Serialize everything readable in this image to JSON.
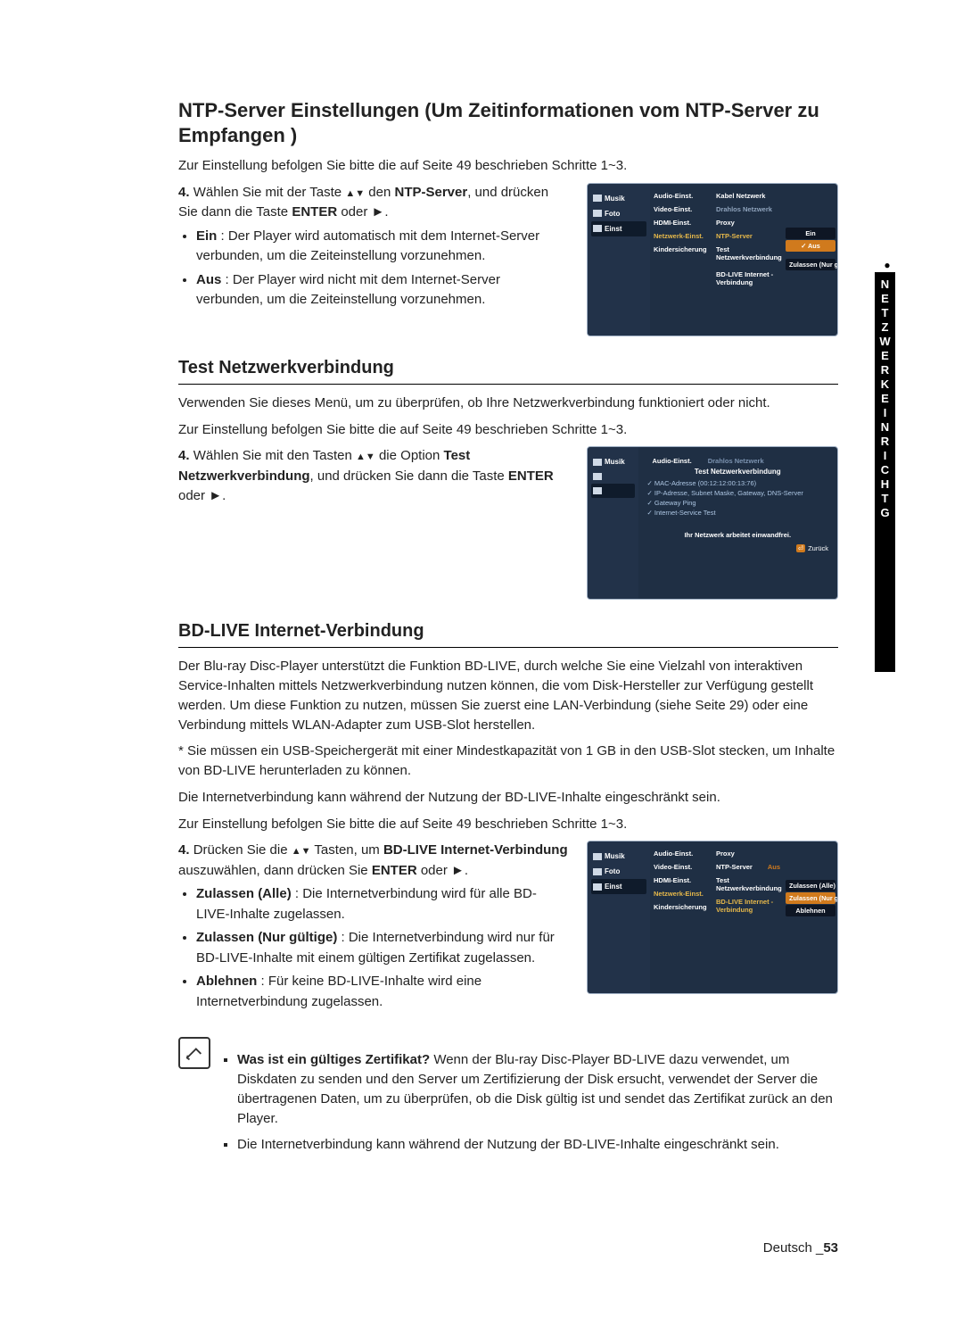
{
  "sidetab": {
    "label": "NETZWERKEINRICHTG"
  },
  "h1": "NTP-Server Einstellungen (Um Zeitinformationen vom NTP-Server zu Empfangen )",
  "intro1": "Zur Einstellung befolgen Sie bitte die auf Seite 49 beschrieben Schritte 1~3.",
  "step4a": {
    "num": "4.",
    "lead_a": "Wählen Sie mit der Taste ",
    "lead_b": " den ",
    "key_name": "NTP-Server",
    "lead_c": ", und drücken Sie dann die Taste ",
    "enter": "ENTER",
    "lead_d": " oder ",
    "tri": "►",
    "lead_e": ".",
    "bullets": [
      {
        "name": "Ein",
        "text": " : Der Player wird automatisch mit dem Internet-Server verbunden, um die Zeiteinstellung vorzunehmen."
      },
      {
        "name": "Aus",
        "text": " : Der Player wird nicht mit dem Internet-Server verbunden, um die Zeiteinstellung vorzunehmen."
      }
    ]
  },
  "osd1": {
    "side": [
      "Musik",
      "Foto",
      "Einst"
    ],
    "colA": [
      "Audio-Einst.",
      "Video-Einst.",
      "HDMI-Einst.",
      "Netzwerk-Einst.",
      "Kindersicherung"
    ],
    "colB": [
      "Kabel Netzwerk",
      "Drahlos Netzwerk",
      "Proxy",
      "NTP-Server",
      "Test Netzwerkverbindung",
      "BD-LIVE\nInternet - Verbindung"
    ],
    "colC": [
      "Ein",
      "✓ Aus",
      "Zulassen\n(Nur gültige)"
    ]
  },
  "h2": "Test Netzwerkverbindung",
  "test_intro": "Verwenden Sie dieses Menü, um zu überprüfen, ob Ihre Netzwerkverbindung funktioniert oder nicht.",
  "intro2": "Zur Einstellung befolgen Sie bitte die auf Seite 49 beschrieben Schritte 1~3.",
  "step4b": {
    "num": "4.",
    "lead_a": "Wählen Sie mit den Tasten ",
    "lead_b": " die Option ",
    "key_name": "Test Netzwerkverbindung",
    "lead_c": ", und drücken Sie dann die Taste ",
    "enter": "ENTER",
    "lead_d": " oder ",
    "tri": "►",
    "lead_e": "."
  },
  "osd2": {
    "topA": "Audio-Einst.",
    "topB": "Drahlos Netzwerk",
    "title": "Test Netzwerkverbindung",
    "checks": [
      "✓ MAC-Adresse (00:12:12:00:13:76)",
      "✓ IP-Adresse, Subnet Maske, Gateway, DNS-Server",
      "✓ Gateway Ping",
      "✓ Internet-Service Test"
    ],
    "status": "Ihr Netzwerk arbeitet einwandfrei.",
    "back_pre": "⏎",
    "back": "Zurück",
    "side": [
      "Musik",
      "",
      ""
    ]
  },
  "h3": "BD-LIVE Internet-Verbindung",
  "bd_paras": [
    "Der Blu-ray Disc-Player unterstützt die Funktion BD-LIVE, durch welche Sie eine Vielzahl von interaktiven Service-Inhalten mittels Netzwerkverbindung nutzen können, die vom Disk-Hersteller zur Verfügung gestellt werden. Um diese Funktion zu nutzen, müssen Sie zuerst eine LAN-Verbindung (siehe Seite 29) oder eine Verbindung mittels WLAN-Adapter zum USB-Slot herstellen.",
    "* Sie müssen ein USB-Speichergerät mit einer Mindestkapazität von 1 GB in den USB-Slot stecken, um Inhalte von BD-LIVE herunterladen zu können.",
    "Die Internetverbindung kann während der Nutzung der BD-LIVE-Inhalte eingeschränkt sein.",
    "Zur Einstellung befolgen Sie bitte die auf Seite 49 beschrieben Schritte 1~3."
  ],
  "step4c": {
    "num": "4.",
    "lead_a": "Drücken Sie die ",
    "lead_b": " Tasten, um ",
    "key_name": "BD-LIVE Internet-Verbindung",
    "lead_c": " auszuwählen, dann drücken Sie ",
    "enter": "ENTER",
    "lead_d": " oder ",
    "tri": "►",
    "lead_e": ".",
    "bullets": [
      {
        "name": "Zulassen (Alle)",
        "text": " : Die Internetverbindung wird für alle BD-LIVE-Inhalte zugelassen."
      },
      {
        "name": "Zulassen (Nur gültige)",
        "text": " : Die Internetverbindung wird nur für BD-LIVE-Inhalte mit einem gültigen Zertifikat zugelassen."
      },
      {
        "name": "Ablehnen",
        "text": " : Für keine BD-LIVE-Inhalte wird eine Internetverbindung zugelassen."
      }
    ]
  },
  "osd3": {
    "side": [
      "Musik",
      "Foto",
      "Einst"
    ],
    "colA": [
      "Audio-Einst.",
      "Video-Einst.",
      "HDMI-Einst.",
      "Netzwerk-Einst.",
      "Kindersicherung"
    ],
    "colB": [
      "Proxy",
      "NTP-Server",
      "Test Netzwerkverbindung",
      "BD-LIVE\nInternet - Verbindung"
    ],
    "colB_val": "Aus",
    "colC": [
      "Zulassen (Alle)",
      "Zulassen \n(Nur gültige)",
      "Ablehnen"
    ]
  },
  "notes": [
    {
      "q": "Was ist ein gültiges Zertifikat?",
      "t": " Wenn der Blu-ray Disc-Player BD-LIVE dazu verwendet, um Diskdaten zu senden und den Server um Zertifizierung der Disk ersucht, verwendet der Server die übertragenen Daten, um zu überprüfen, ob die Disk gültig ist und sendet das Zertifikat zurück an den Player."
    },
    {
      "q": "",
      "t": "Die Internetverbindung kann während der Nutzung der BD-LIVE-Inhalte eingeschränkt sein."
    }
  ],
  "footer": {
    "lang": "Deutsch _",
    "page": "53"
  }
}
